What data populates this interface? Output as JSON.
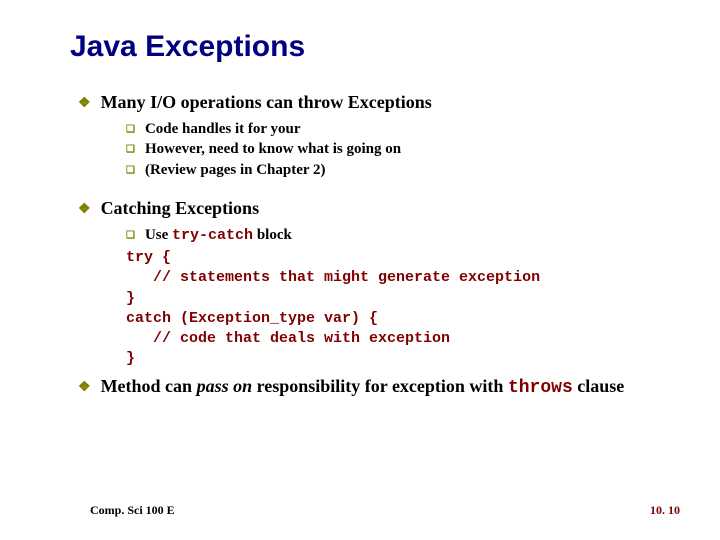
{
  "title": "Java Exceptions",
  "b1": {
    "heading": "Many I/O operations can throw Exceptions",
    "items": [
      "Code handles it for your",
      "However, need to know what is going on",
      "(Review pages in Chapter 2)"
    ]
  },
  "b2": {
    "heading": "Catching Exceptions",
    "use_prefix": "Use ",
    "use_code": "try-catch",
    "use_suffix": " block",
    "code": "try {\n   // statements that might generate exception\n}\ncatch (Exception_type var) {\n   // code that deals with exception\n}"
  },
  "b3": {
    "t1": "Method can ",
    "t2_italic": "pass on",
    "t3": " responsibility for exception with ",
    "t4_code": "throws",
    "t5": " clause"
  },
  "footer": {
    "left": "Comp. Sci 100 E",
    "right": "10. 10"
  }
}
